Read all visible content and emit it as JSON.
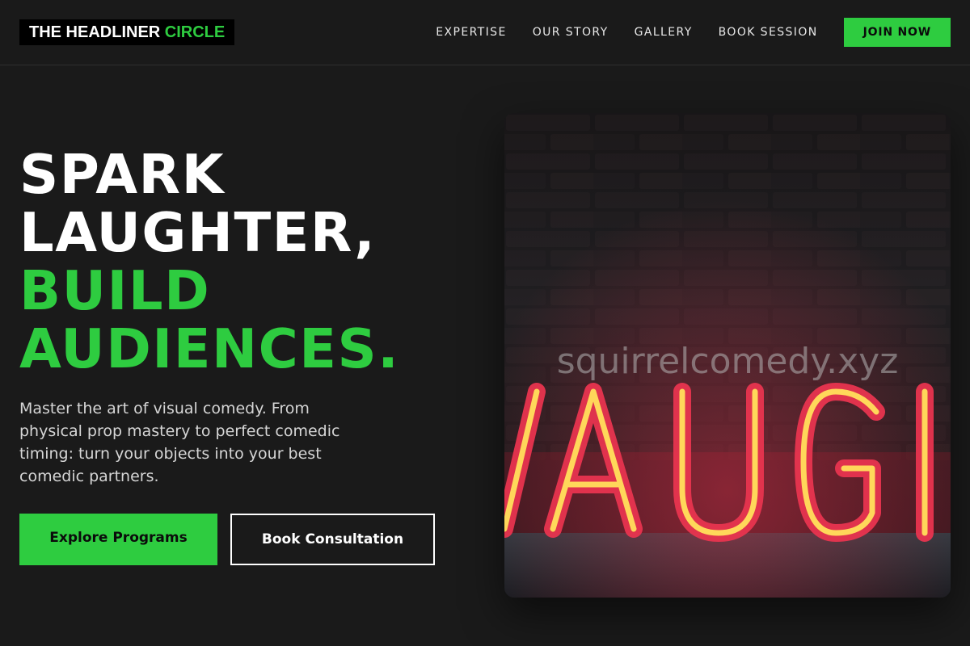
{
  "brand": {
    "name_part1": "THE HEADLINER",
    "name_part2": "CIRCLE"
  },
  "nav": {
    "links": [
      "EXPERTISE",
      "OUR STORY",
      "GALLERY",
      "BOOK SESSION"
    ],
    "cta_label": "JOIN NOW"
  },
  "hero": {
    "headline_lines": [
      "SPARK",
      "LAUGHTER,"
    ],
    "headline_accent_lines": [
      "BUILD",
      "AUDIENCES."
    ],
    "description": "Master the art of visual comedy. From physical prop mastery to perfect comedic timing: turn your objects into your best comedic partners.",
    "primary_button": "Explore Programs",
    "secondary_button": "Book Consultation",
    "image": {
      "icon": "neon-sign-photo",
      "neon_text": "AUGH",
      "watermark": "squirrelcomedy.xyz"
    }
  },
  "colors": {
    "background": "#1a1a1a",
    "accent": "#2ecc40",
    "neon_red": "#e8344f",
    "neon_yellow": "#ffd75a"
  }
}
